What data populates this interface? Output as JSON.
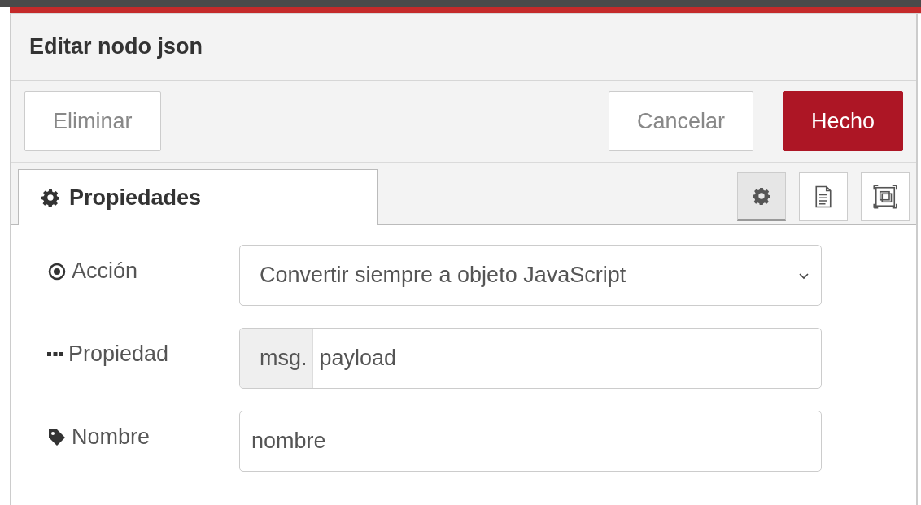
{
  "dialog": {
    "title": "Editar nodo json"
  },
  "buttons": [
    {
      "label": "Eliminar",
      "kind": "plain"
    },
    {
      "label": "Cancelar",
      "kind": "plain"
    },
    {
      "label": "Hecho",
      "kind": "primary"
    }
  ],
  "tabs": [
    {
      "label": "Propiedades",
      "selected": true
    }
  ],
  "tool_tabs": [
    {
      "kind": "gear",
      "selected": true
    },
    {
      "kind": "document",
      "selected": false
    },
    {
      "kind": "frame",
      "selected": false
    }
  ],
  "fields": [
    {
      "kind": "select",
      "label": "Acción",
      "value": "Convertir siempre a objeto JavaScript"
    },
    {
      "kind": "typed",
      "label": "Propiedad",
      "prefix": "msg.",
      "value": "payload"
    },
    {
      "kind": "text",
      "label": "Nombre",
      "value": "nombre"
    }
  ]
}
